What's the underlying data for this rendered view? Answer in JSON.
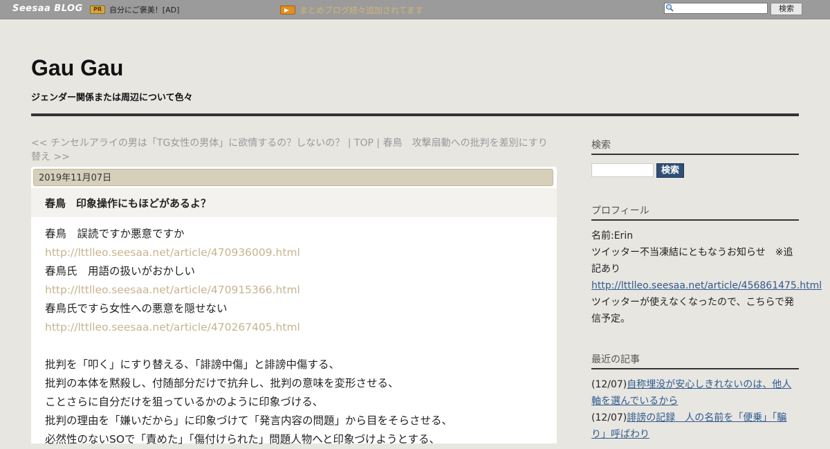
{
  "topbar": {
    "logo": "Seesaa BLOG",
    "pr_badge": "PR",
    "ad_text": "自分にご褒美！[AD]",
    "notice": "まとめブログ続々追加されてます",
    "search_placeholder": "",
    "search_button": "検索"
  },
  "header": {
    "title": "Gau Gau",
    "description": "ジェンダー関係または周辺について色々"
  },
  "nav": {
    "prev": "<< チンセルアライの男は「TG女性の男体」に欲情するの？しないの？",
    "sep1": " | ",
    "top": "TOP",
    "sep2": " | ",
    "next": "春鳥　攻撃扇動への批判を差別にすり替え >>"
  },
  "article": {
    "date": "2019年11月07日",
    "title": "春鳥　印象操作にもほどがあるよ？",
    "lines": [
      {
        "text": "春鳥　誤読ですか悪意ですか",
        "type": "text"
      },
      {
        "text": "http://lttlleo.seesaa.net/article/470936009.html",
        "type": "link"
      },
      {
        "text": "春鳥氏　用語の扱いがおかしい",
        "type": "text"
      },
      {
        "text": "http://lttlleo.seesaa.net/article/470915366.html",
        "type": "link"
      },
      {
        "text": "春鳥氏ですら女性への悪意を隠せない",
        "type": "text"
      },
      {
        "text": "http://lttlleo.seesaa.net/article/470267405.html",
        "type": "link"
      },
      {
        "text": "",
        "type": "blank"
      },
      {
        "text": "批判を「叩く」にすり替える、「誹謗中傷」と誹謗中傷する、",
        "type": "text"
      },
      {
        "text": "批判の本体を黙殺し、付随部分だけで抗弁し、批判の意味を変形させる、",
        "type": "text"
      },
      {
        "text": "ことさらに自分だけを狙っているかのように印象づける、",
        "type": "text"
      },
      {
        "text": "批判の理由を「嫌いだから」に印象づけて「発言内容の問題」から目をそらさせる、",
        "type": "text"
      },
      {
        "text": "必然性のないSOで「責めた」「傷付けられた」問題人物へと印象づけようとする、",
        "type": "text"
      }
    ]
  },
  "sidebar": {
    "search_heading": "検索",
    "search_button": "検索",
    "profile_heading": "プロフィール",
    "profile_name": "名前:Erin",
    "profile_line1": "ツイッター不当凍結にともなうお知らせ　※追記あり",
    "profile_link": "http://lttlleo.seesaa.net/article/456861475.html",
    "profile_line2": "ツイッターが使えなくなったので、こちらで発信予定。",
    "recent_heading": "最近の記事",
    "recent": [
      {
        "date": "(12/07)",
        "title": "自称埋没が安心しきれないのは、他人軸を選んでいるから"
      },
      {
        "date": "(12/07)",
        "title": "誹謗の記録　人の名前を「便乗」「騙り」呼ばわり"
      }
    ]
  }
}
